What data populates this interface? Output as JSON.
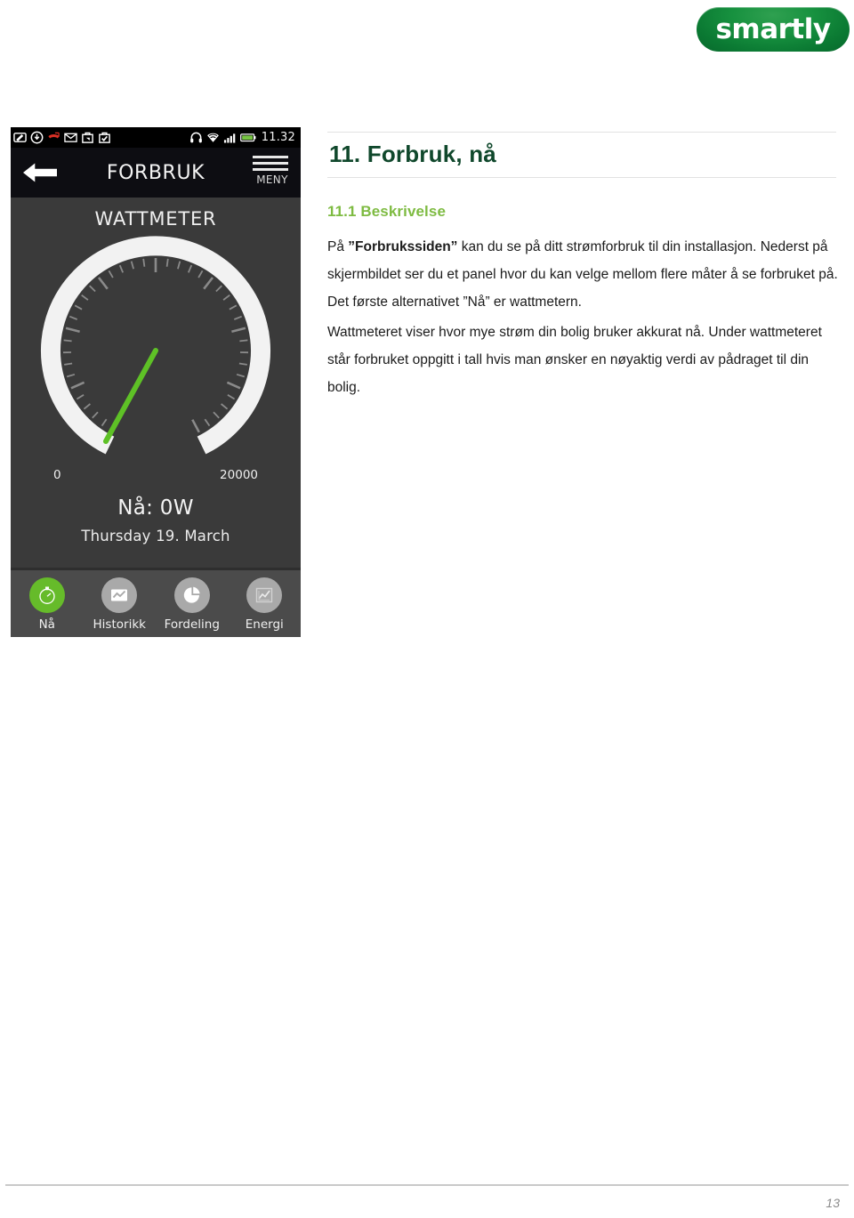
{
  "brand": {
    "logo_text": "smartly",
    "green_dark": "#0b7a33",
    "green_light": "#7ebb42"
  },
  "document": {
    "title": "11. Forbruk, nå",
    "section_number_title": "11.1  Beskrivelse",
    "paragraph_1_pre": "På ",
    "paragraph_1_bold": "”Forbrukssiden”",
    "paragraph_1_post": " kan du se på ditt strømforbruk til din installasjon. Nederst på skjermbildet ser du et panel hvor du kan velge mellom flere måter å se forbruket på. Det første alternativet ”Nå” er wattmetern.",
    "paragraph_2": "Wattmeteret viser hvor mye strøm din bolig bruker akkurat nå. Under wattmeteret står forbruket oppgitt i tall hvis man ønsker en nøyaktig verdi av pådraget til din bolig.",
    "page_number": "13"
  },
  "phone": {
    "statusbar": {
      "time": "11.32",
      "left_icons": [
        "note-icon",
        "download-clock-icon",
        "missed-call-icon",
        "mail-icon",
        "app-bag-icon",
        "app-check-bag-icon"
      ],
      "right_icons": [
        "headphone-icon",
        "wifi-icon",
        "signal-bars-icon",
        "battery-icon"
      ]
    },
    "navbar": {
      "back_icon": "back-arrow-icon",
      "title": "FORBRUK",
      "menu_label": "MENY"
    },
    "screen": {
      "section_title": "WATTMETER",
      "gauge": {
        "min_label": "0",
        "max_label": "20000",
        "needle_color": "#5ec126",
        "arc_color": "#f2f2f2"
      },
      "now_value": "Nå: 0W",
      "date": "Thursday 19. March"
    },
    "tabs": [
      {
        "label": "Nå",
        "icon": "stopwatch-icon",
        "active": true
      },
      {
        "label": "Historikk",
        "icon": "line-chart-icon",
        "active": false
      },
      {
        "label": "Fordeling",
        "icon": "pie-chart-icon",
        "active": false
      },
      {
        "label": "Energi",
        "icon": "graph-icon",
        "active": false
      }
    ]
  },
  "chart_data": {
    "type": "gauge",
    "title": "WATTMETER",
    "value": 0,
    "unit": "W",
    "value_label": "Nå: 0W",
    "range_min": 0,
    "range_max": 20000,
    "tick_labels": [
      "0",
      "20000"
    ],
    "annotation": "Thursday 19. March",
    "needle_color": "#5ec126",
    "track_color": "#f2f2f2",
    "background": "#2e2e2e"
  }
}
